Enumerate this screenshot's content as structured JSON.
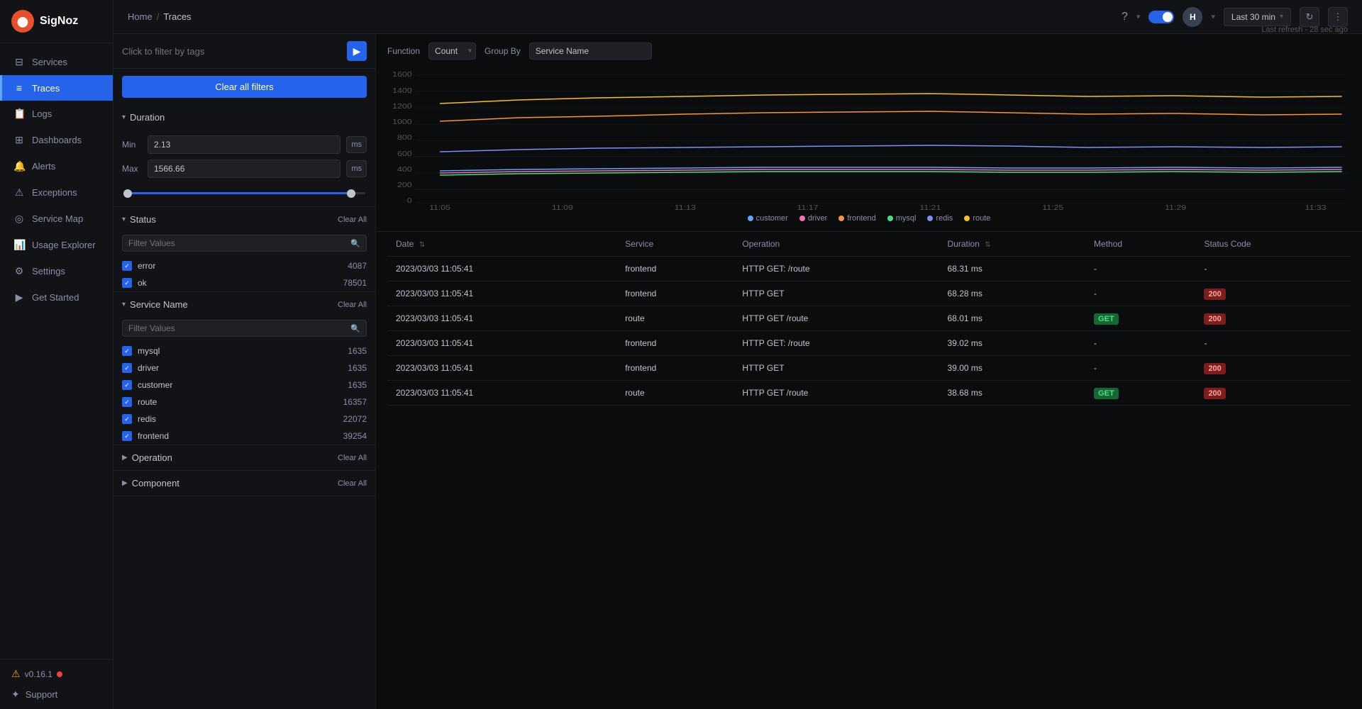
{
  "app": {
    "logo_text": "SigNoz",
    "logo_initial": "●"
  },
  "sidebar": {
    "items": [
      {
        "id": "services",
        "label": "Services",
        "icon": "≡"
      },
      {
        "id": "traces",
        "label": "Traces",
        "icon": "≡",
        "active": true
      },
      {
        "id": "logs",
        "label": "Logs",
        "icon": "≡"
      },
      {
        "id": "dashboards",
        "label": "Dashboards",
        "icon": "⊞"
      },
      {
        "id": "alerts",
        "label": "Alerts",
        "icon": "🔔"
      },
      {
        "id": "exceptions",
        "label": "Exceptions",
        "icon": "⚠"
      },
      {
        "id": "service-map",
        "label": "Service Map",
        "icon": "◎"
      },
      {
        "id": "usage-explorer",
        "label": "Usage Explorer",
        "icon": "📊"
      },
      {
        "id": "settings",
        "label": "Settings",
        "icon": "⚙"
      },
      {
        "id": "get-started",
        "label": "Get Started",
        "icon": "▶"
      }
    ],
    "version": "v0.16.1",
    "support_label": "Support"
  },
  "topbar": {
    "breadcrumb_home": "Home",
    "breadcrumb_sep": "/",
    "breadcrumb_current": "Traces",
    "time_selector": "Last 30 min",
    "last_refresh": "Last refresh - 28 sec ago",
    "user_initial": "H",
    "help_label": "?"
  },
  "filter": {
    "search_placeholder": "Click to filter by tags",
    "clear_all_btn": "Clear all filters",
    "duration": {
      "title": "Duration",
      "min_label": "Min",
      "min_value": "2.13",
      "min_unit": "ms",
      "max_label": "Max",
      "max_value": "1566.66",
      "max_unit": "ms"
    },
    "status": {
      "title": "Status",
      "clear_label": "Clear All",
      "filter_placeholder": "Filter Values",
      "items": [
        {
          "label": "error",
          "count": "4087",
          "checked": true
        },
        {
          "label": "ok",
          "count": "78501",
          "checked": true
        }
      ]
    },
    "service_name": {
      "title": "Service Name",
      "clear_label": "Clear All",
      "filter_placeholder": "Filter Values",
      "items": [
        {
          "label": "mysql",
          "count": "1635",
          "checked": true
        },
        {
          "label": "driver",
          "count": "1635",
          "checked": true
        },
        {
          "label": "customer",
          "count": "1635",
          "checked": true
        },
        {
          "label": "route",
          "count": "16357",
          "checked": true
        },
        {
          "label": "redis",
          "count": "22072",
          "checked": true
        },
        {
          "label": "frontend",
          "count": "39254",
          "checked": true
        }
      ]
    },
    "operation": {
      "title": "Operation",
      "clear_label": "Clear All"
    },
    "component": {
      "title": "Component",
      "clear_label": "Clear All"
    }
  },
  "chart": {
    "function_label": "Function",
    "function_value": "Count",
    "group_by_label": "Group By",
    "group_by_value": "Service Name",
    "y_labels": [
      "1600",
      "1400",
      "1200",
      "1000",
      "800",
      "600",
      "400",
      "200",
      "0"
    ],
    "x_labels": [
      "11:05",
      "11:09",
      "11:13",
      "11:17",
      "11:21",
      "11:25",
      "11:29",
      "11:33"
    ],
    "legend": [
      {
        "name": "customer",
        "color": "#60a5fa"
      },
      {
        "name": "driver",
        "color": "#f472b6"
      },
      {
        "name": "frontend",
        "color": "#fb923c"
      },
      {
        "name": "mysql",
        "color": "#4ade80"
      },
      {
        "name": "redis",
        "color": "#818cf8"
      },
      {
        "name": "route",
        "color": "#fbbf24"
      }
    ]
  },
  "table": {
    "columns": [
      {
        "id": "date",
        "label": "Date",
        "sortable": true
      },
      {
        "id": "service",
        "label": "Service",
        "sortable": false
      },
      {
        "id": "operation",
        "label": "Operation",
        "sortable": false
      },
      {
        "id": "duration",
        "label": "Duration",
        "sortable": true
      },
      {
        "id": "method",
        "label": "Method",
        "sortable": false
      },
      {
        "id": "status_code",
        "label": "Status Code",
        "sortable": false
      }
    ],
    "rows": [
      {
        "date": "2023/03/03 11:05:41",
        "service": "frontend",
        "operation": "HTTP GET: /route",
        "duration": "68.31 ms",
        "method": "-",
        "status_code": "-"
      },
      {
        "date": "2023/03/03 11:05:41",
        "service": "frontend",
        "operation": "HTTP GET",
        "duration": "68.28 ms",
        "method": "-",
        "status_code": "200"
      },
      {
        "date": "2023/03/03 11:05:41",
        "service": "route",
        "operation": "HTTP GET /route",
        "duration": "68.01 ms",
        "method": "GET",
        "status_code": "200"
      },
      {
        "date": "2023/03/03 11:05:41",
        "service": "frontend",
        "operation": "HTTP GET: /route",
        "duration": "39.02 ms",
        "method": "-",
        "status_code": "-"
      },
      {
        "date": "2023/03/03 11:05:41",
        "service": "frontend",
        "operation": "HTTP GET",
        "duration": "39.00 ms",
        "method": "-",
        "status_code": "200"
      },
      {
        "date": "2023/03/03 11:05:41",
        "service": "route",
        "operation": "HTTP GET /route",
        "duration": "38.68 ms",
        "method": "GET",
        "status_code": "200"
      }
    ]
  },
  "colors": {
    "accent": "#2563eb",
    "sidebar_active": "#2563eb",
    "customer": "#60a5fa",
    "driver": "#f472b6",
    "frontend": "#fb923c",
    "mysql": "#4ade80",
    "redis": "#818cf8",
    "route": "#fbbf24"
  }
}
